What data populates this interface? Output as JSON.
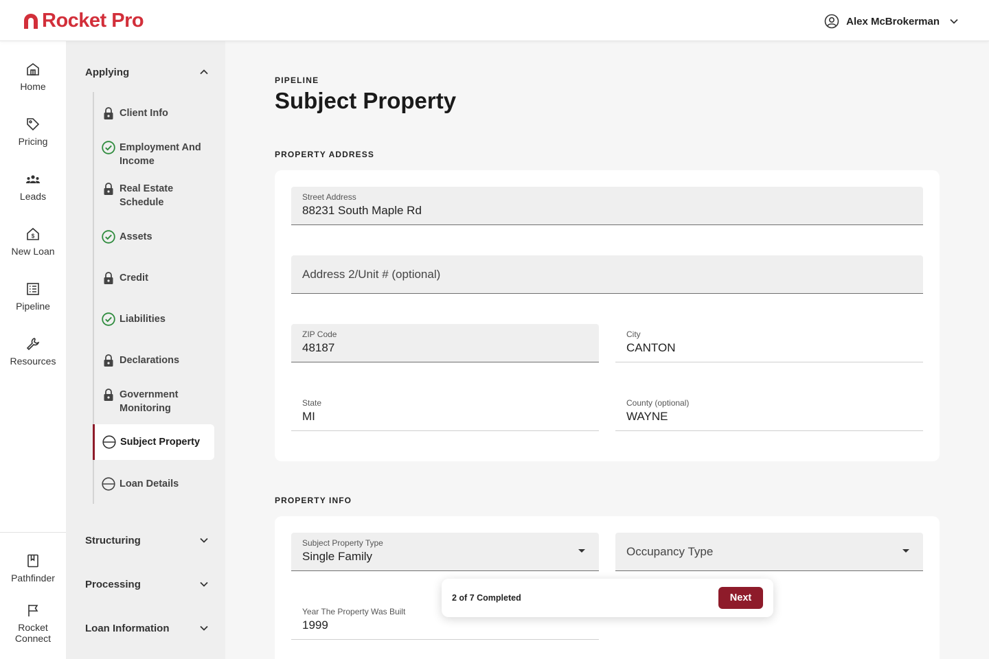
{
  "header": {
    "brand": "Rocket Pro",
    "user_name": "Alex McBrokerman"
  },
  "rail": {
    "items": [
      {
        "label": "Home",
        "icon": "home-icon"
      },
      {
        "label": "Pricing",
        "icon": "tag-icon"
      },
      {
        "label": "Leads",
        "icon": "people-icon"
      },
      {
        "label": "New Loan",
        "icon": "house-dollar-icon"
      },
      {
        "label": "Pipeline",
        "icon": "list-icon"
      },
      {
        "label": "Resources",
        "icon": "wrench-icon"
      }
    ],
    "bottom_items": [
      {
        "label": "Pathfinder",
        "icon": "book-icon"
      },
      {
        "label": "Rocket\nConnect",
        "line1": "Rocket",
        "line2": "Connect",
        "icon": "flag-icon"
      }
    ]
  },
  "steps": {
    "applying_title": "Applying",
    "items": [
      {
        "label": "Client Info",
        "status": "locked"
      },
      {
        "label": "Employment And",
        "label2": "Income",
        "status": "complete"
      },
      {
        "label": "Real Estate",
        "label2": "Schedule",
        "status": "locked"
      },
      {
        "label": "Assets",
        "status": "complete"
      },
      {
        "label": "Credit",
        "status": "locked"
      },
      {
        "label": "Liabilities",
        "status": "complete"
      },
      {
        "label": "Declarations",
        "status": "locked"
      },
      {
        "label": "Government",
        "label2": "Monitoring",
        "status": "locked"
      },
      {
        "label": "Subject Property",
        "status": "in-progress"
      },
      {
        "label": "Loan Details",
        "status": "in-progress"
      }
    ],
    "structuring_title": "Structuring",
    "processing_title": "Processing",
    "loan_info_title": "Loan Information"
  },
  "page": {
    "eyebrow": "PIPELINE",
    "title": "Subject Property",
    "address_section": "PROPERTY ADDRESS",
    "info_section": "PROPERTY INFO"
  },
  "address": {
    "street_label": "Street Address",
    "street_value": "88231 South Maple Rd",
    "address2_placeholder": "Address 2/Unit # (optional)",
    "zip_label": "ZIP Code",
    "zip_value": "48187",
    "city_label": "City",
    "city_value": "CANTON",
    "state_label": "State",
    "state_value": "MI",
    "county_label": "County (optional)",
    "county_value": "WAYNE"
  },
  "info": {
    "property_type_label": "Subject Property Type",
    "property_type_value": "Single Family",
    "occupancy_placeholder": "Occupancy Type",
    "year_label": "Year The Property Was Built",
    "year_value": "1999"
  },
  "progress": {
    "text": "2 of 7 Completed",
    "completed": 2,
    "total": 7,
    "next_label": "Next"
  },
  "colors": {
    "brand_red": "#d22f3a",
    "accent_maroon": "#8e1b2a",
    "complete_green": "#2e8b3d"
  }
}
